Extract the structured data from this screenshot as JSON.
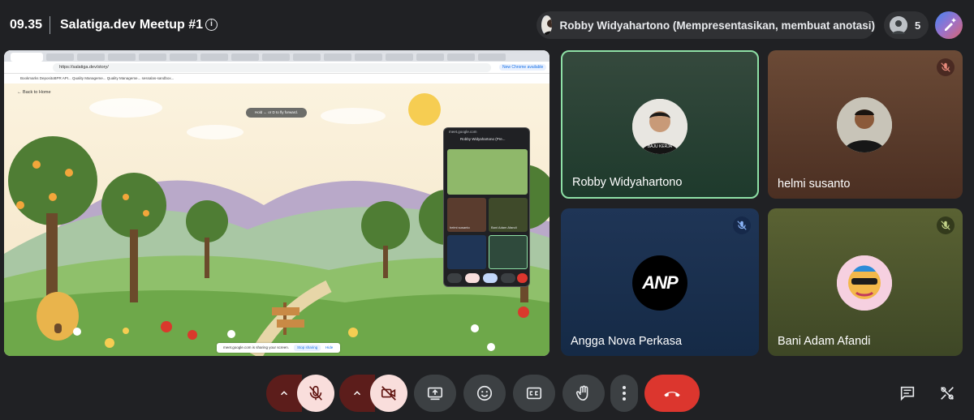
{
  "meeting": {
    "time": "09.35",
    "title": "Salatiga.dev Meetup #1",
    "info_icon": "info-icon"
  },
  "presenter": {
    "label": "Robby Widyahartono (Mempresentasikan, membuat anotasi)"
  },
  "people": {
    "count": "5"
  },
  "shared_screen": {
    "url": "https://salatiga.dev/story/",
    "new_chrome": "New Chrome available",
    "bookmarks": "Bookmarks   DepositoBPR API...   Quality Manageme...   Quality Manageme...   sessalas-sandbox...",
    "back_home": "← Back to Home",
    "tooltip": "Hold ← or D to fly forward.",
    "sharing_notice": "meet.google.com is sharing your screen.",
    "stop_sharing": "Stop sharing",
    "hide": "Hide",
    "mini_window": {
      "url": "meet.google.com",
      "title": "Robby Widyahartono (Pre...",
      "tiles": [
        "helmi susanto",
        "Bani Adam Afandi"
      ]
    }
  },
  "participants": [
    {
      "name": "Robby Widyahartono",
      "muted": false,
      "speaking": true
    },
    {
      "name": "helmi susanto",
      "muted": true
    },
    {
      "name": "Angga Nova Perkasa",
      "muted": true,
      "avatar_text": "ANP"
    },
    {
      "name": "Bani Adam Afandi",
      "muted": true
    }
  ],
  "controls": {
    "mic_options": "chevron-up-icon",
    "mic": "mic-off-icon",
    "cam_options": "chevron-up-icon",
    "camera": "camera-off-icon",
    "present": "present-screen-icon",
    "reactions": "emoji-icon",
    "captions": "captions-icon",
    "raise_hand": "hand-icon",
    "more": "more-vert-icon",
    "leave": "call-end-icon",
    "chat": "chat-icon",
    "activities": "activities-icon"
  },
  "colors": {
    "background": "#202124",
    "active_speaker_border": "#8ee0a6",
    "leave": "#dc362e",
    "muted_control": "#f9dedc"
  }
}
